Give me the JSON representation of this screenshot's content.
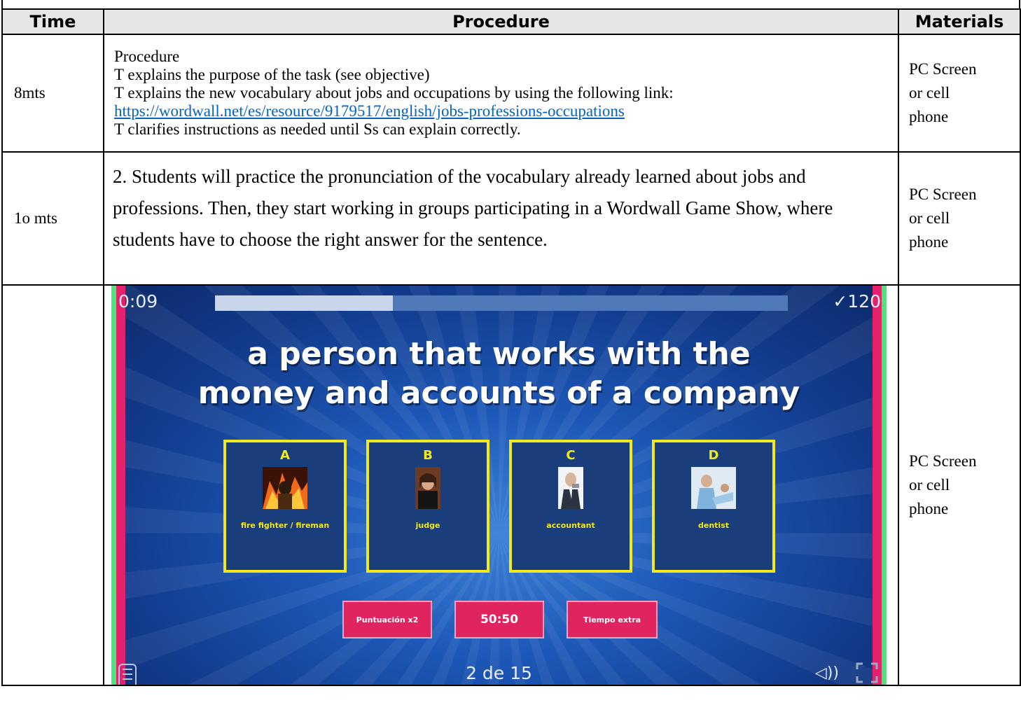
{
  "table": {
    "headers": {
      "time": "Time",
      "procedure": "Procedure",
      "materials": "Materials"
    },
    "rows": [
      {
        "time": "8mts",
        "procedure_lines": [
          "Procedure",
          "T explains the purpose of the task (see objective)",
          "T explains the new vocabulary about jobs and occupations by using the following link:"
        ],
        "link": "https://wordwall.net/es/resource/9179517/english/jobs-professions-occupations",
        "procedure_last": "T clarifies instructions as needed until Ss can explain correctly.",
        "materials_lines": [
          "PC Screen",
          "or cell",
          "phone"
        ]
      },
      {
        "time": "1o mts",
        "procedure": "2. Students will practice the pronunciation of the vocabulary already learned about jobs and professions. Then, they start working in groups participating in a Wordwall Game Show, where students have to choose the right answer for the sentence.",
        "materials_lines": [
          "PC Screen",
          "or cell",
          "phone"
        ]
      },
      {
        "time": "",
        "materials_lines": [
          "PC Screen",
          "or cell",
          "phone"
        ]
      }
    ]
  },
  "game": {
    "timer": "0:09",
    "progress_fraction": 0.31,
    "score": "✓120",
    "question_line1": "a person that works with the",
    "question_line2": "money and accounts of a company",
    "answers": [
      {
        "letter": "A",
        "label": "fire fighter / fireman"
      },
      {
        "letter": "B",
        "label": "judge"
      },
      {
        "letter": "C",
        "label": "accountant"
      },
      {
        "letter": "D",
        "label": "dentist"
      }
    ],
    "powerups": [
      "Puntuación x2",
      "50:50",
      "Tiempo extra"
    ],
    "counter": "2 de 15",
    "colors": {
      "accent_yellow": "#f1e81d",
      "powerup_pink": "#e0245f",
      "side_green": "#47e57a",
      "side_pink": "#e3226b"
    },
    "icons": [
      "menu-icon",
      "sound-icon",
      "fullscreen-icon"
    ]
  }
}
